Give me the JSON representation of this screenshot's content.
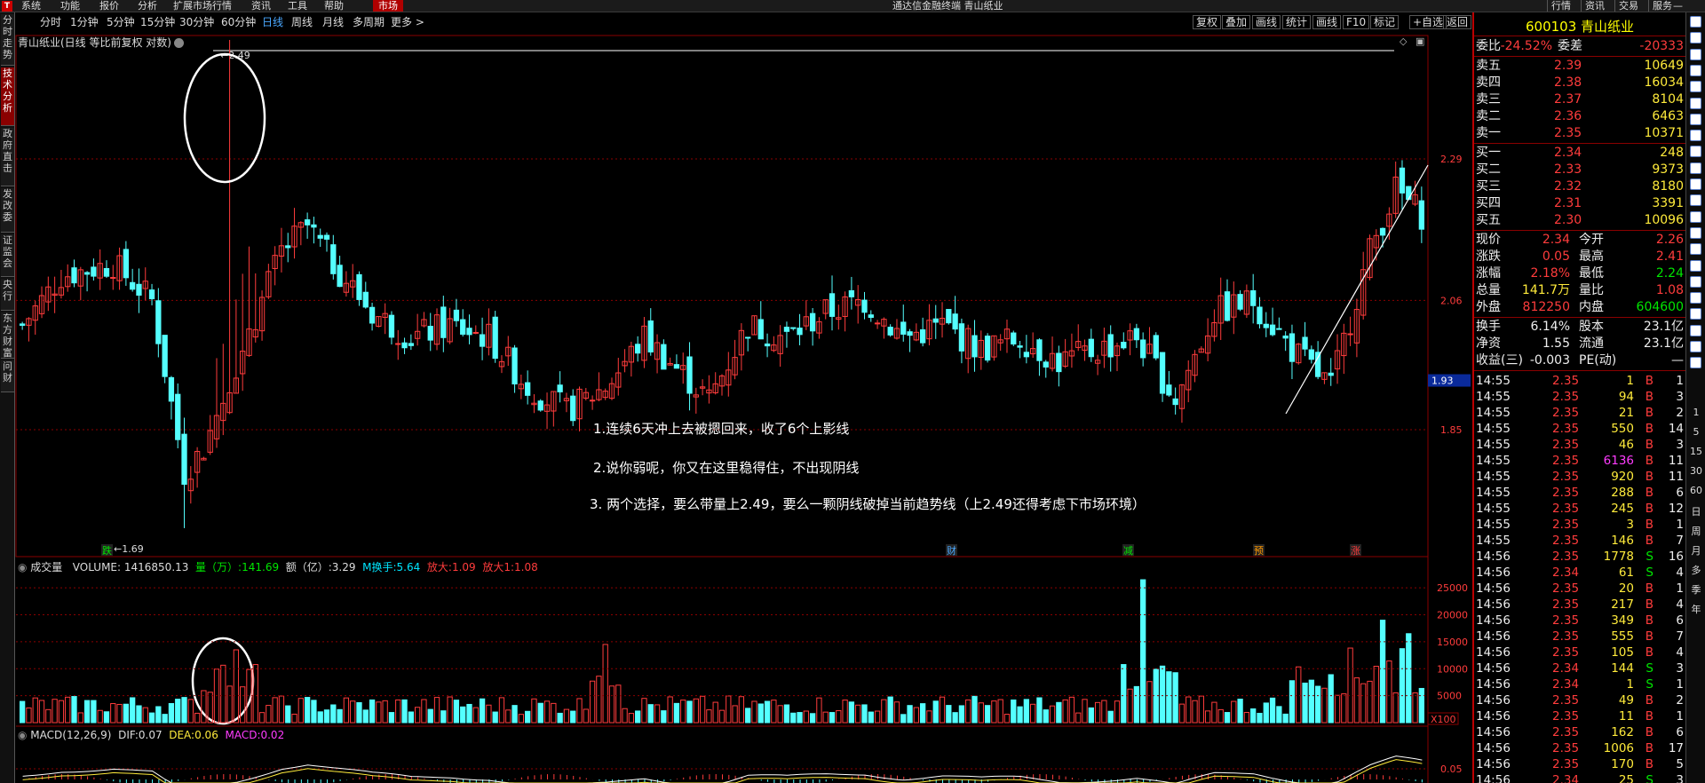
{
  "menubar": {
    "items": [
      "系统",
      "功能",
      "报价",
      "分析",
      "扩展市场行情",
      "资讯",
      "工具",
      "帮助"
    ],
    "active": "市场",
    "title": "通达信金融终端 青山纸业",
    "right": [
      "行情",
      "资讯",
      "交易",
      "服务"
    ]
  },
  "left_tabs": [
    "分时走势",
    "技术分析",
    "政府直击",
    "发改委",
    "证监会",
    "央行",
    "东方财富",
    "问财"
  ],
  "period_bar": {
    "periods": [
      "分时",
      "1分钟",
      "5分钟",
      "15分钟",
      "30分钟",
      "60分钟",
      "日线",
      "周线",
      "月线",
      "多周期",
      "更多 >"
    ],
    "active": "日线",
    "buttons": [
      "复权",
      "叠加",
      "画线",
      "统计",
      "画线",
      "F10",
      "标记",
      "+自选",
      "返回"
    ]
  },
  "chart_title": "青山纸业(日线 等比前复权 对数)",
  "price_axis": {
    "ticks": [
      {
        "label": "2.29",
        "price": 2.29
      },
      {
        "label": "2.06",
        "price": 2.06
      },
      {
        "label": "1.85",
        "price": 1.85
      }
    ],
    "current": "1.93",
    "high_label": "2.49",
    "low_label": "1.69"
  },
  "event_markers": [
    "跌",
    "财",
    "减",
    "预",
    "涨"
  ],
  "annotations": [
    "1.连续6天冲上去被摁回来，收了6个上影线",
    "2.说你弱呢，你又在这里稳得住，不出现阴线",
    "3. 两个选择，要么带量上2.49，要么一颗阴线破掉当前趋势线（上2.49还得考虑下市场环境）"
  ],
  "volume_header": {
    "label": "成交量",
    "volume": "VOLUME: 1416850.13",
    "qty_label": "量（万）:",
    "qty": "141.69",
    "amt_label": "额（亿）:",
    "amt": "3.29",
    "turn_label": "M换手:",
    "turn": "5.64",
    "amp_label": "放大:",
    "amp": "1.09",
    "amp2_label": "放大1:",
    "amp2": "1.08"
  },
  "volume_axis": [
    "25000",
    "20000",
    "15000",
    "10000",
    "5000"
  ],
  "volume_unit": "X100",
  "macd_header": {
    "label": "MACD(12,26,9)",
    "dif_label": "DIF:",
    "dif": "0.07",
    "dea_label": "DEA:",
    "dea": "0.06",
    "macd_label": "MACD:",
    "macd": "0.02"
  },
  "macd_axis": "0.05",
  "quote": {
    "code_name": "600103 青山纸业",
    "weibi_label": "委比",
    "weibi": "-24.52%",
    "weicha_label": "委差",
    "weicha": "-20333",
    "asks": [
      {
        "label": "卖五",
        "price": "2.39",
        "vol": "10649"
      },
      {
        "label": "卖四",
        "price": "2.38",
        "vol": "16034"
      },
      {
        "label": "卖三",
        "price": "2.37",
        "vol": "8104"
      },
      {
        "label": "卖二",
        "price": "2.36",
        "vol": "6463"
      },
      {
        "label": "卖一",
        "price": "2.35",
        "vol": "10371"
      }
    ],
    "bids": [
      {
        "label": "买一",
        "price": "2.34",
        "vol": "248"
      },
      {
        "label": "买二",
        "price": "2.33",
        "vol": "9373"
      },
      {
        "label": "买三",
        "price": "2.32",
        "vol": "8180"
      },
      {
        "label": "买四",
        "price": "2.31",
        "vol": "3391"
      },
      {
        "label": "买五",
        "price": "2.30",
        "vol": "10096"
      }
    ],
    "stats": [
      {
        "l1": "现价",
        "v1": "2.34",
        "l2": "今开",
        "v2": "2.26"
      },
      {
        "l1": "涨跌",
        "v1": "0.05",
        "l2": "最高",
        "v2": "2.41"
      },
      {
        "l1": "涨幅",
        "v1": "2.18%",
        "l2": "最低",
        "v2": "2.24"
      },
      {
        "l1": "总量",
        "v1": "141.7万",
        "l2": "量比",
        "v2": "1.08"
      },
      {
        "l1": "外盘",
        "v1": "812250",
        "l2": "内盘",
        "v2": "604600"
      }
    ],
    "stats2": [
      {
        "l1": "换手",
        "v1": "6.14%",
        "l2": "股本",
        "v2": "23.1亿"
      },
      {
        "l1": "净资",
        "v1": "1.55",
        "l2": "流通",
        "v2": "23.1亿"
      },
      {
        "l1": "收益(三)",
        "v1": "-0.003",
        "l2": "PE(动)",
        "v2": "—"
      }
    ]
  },
  "ticks": [
    {
      "t": "14:55",
      "p": "2.35",
      "v": "1",
      "d": "B",
      "n": "1"
    },
    {
      "t": "14:55",
      "p": "2.35",
      "v": "94",
      "d": "B",
      "n": "3"
    },
    {
      "t": "14:55",
      "p": "2.35",
      "v": "21",
      "d": "B",
      "n": "2"
    },
    {
      "t": "14:55",
      "p": "2.35",
      "v": "550",
      "d": "B",
      "n": "14"
    },
    {
      "t": "14:55",
      "p": "2.35",
      "v": "46",
      "d": "B",
      "n": "3"
    },
    {
      "t": "14:55",
      "p": "2.35",
      "v": "6136",
      "d": "B",
      "n": "11"
    },
    {
      "t": "14:55",
      "p": "2.35",
      "v": "920",
      "d": "B",
      "n": "11"
    },
    {
      "t": "14:55",
      "p": "2.35",
      "v": "288",
      "d": "B",
      "n": "6"
    },
    {
      "t": "14:55",
      "p": "2.35",
      "v": "245",
      "d": "B",
      "n": "12"
    },
    {
      "t": "14:55",
      "p": "2.35",
      "v": "3",
      "d": "B",
      "n": "1"
    },
    {
      "t": "14:55",
      "p": "2.35",
      "v": "146",
      "d": "B",
      "n": "7"
    },
    {
      "t": "14:56",
      "p": "2.35",
      "v": "1778",
      "d": "S",
      "n": "16"
    },
    {
      "t": "14:56",
      "p": "2.34",
      "v": "61",
      "d": "S",
      "n": "4"
    },
    {
      "t": "14:56",
      "p": "2.35",
      "v": "20",
      "d": "B",
      "n": "1"
    },
    {
      "t": "14:56",
      "p": "2.35",
      "v": "217",
      "d": "B",
      "n": "4"
    },
    {
      "t": "14:56",
      "p": "2.35",
      "v": "349",
      "d": "B",
      "n": "6"
    },
    {
      "t": "14:56",
      "p": "2.35",
      "v": "555",
      "d": "B",
      "n": "7"
    },
    {
      "t": "14:56",
      "p": "2.35",
      "v": "105",
      "d": "B",
      "n": "4"
    },
    {
      "t": "14:56",
      "p": "2.34",
      "v": "144",
      "d": "S",
      "n": "3"
    },
    {
      "t": "14:56",
      "p": "2.34",
      "v": "1",
      "d": "S",
      "n": "1"
    },
    {
      "t": "14:56",
      "p": "2.35",
      "v": "49",
      "d": "B",
      "n": "2"
    },
    {
      "t": "14:56",
      "p": "2.35",
      "v": "11",
      "d": "B",
      "n": "1"
    },
    {
      "t": "14:56",
      "p": "2.35",
      "v": "162",
      "d": "B",
      "n": "6"
    },
    {
      "t": "14:56",
      "p": "2.35",
      "v": "1006",
      "d": "B",
      "n": "17"
    },
    {
      "t": "14:56",
      "p": "2.35",
      "v": "170",
      "d": "B",
      "n": "5"
    },
    {
      "t": "14:56",
      "p": "2.34",
      "v": "25",
      "d": "S",
      "n": "3"
    }
  ],
  "right_bar_labels": [
    "1",
    "5",
    "15",
    "30",
    "60",
    "日",
    "周",
    "月",
    "多",
    "季",
    "年"
  ],
  "colors": {
    "up": "#ff3c3c",
    "down": "#54ffff",
    "grid": "#8b0000",
    "dif": "#ffffff",
    "dea": "#ffeb3b"
  }
}
